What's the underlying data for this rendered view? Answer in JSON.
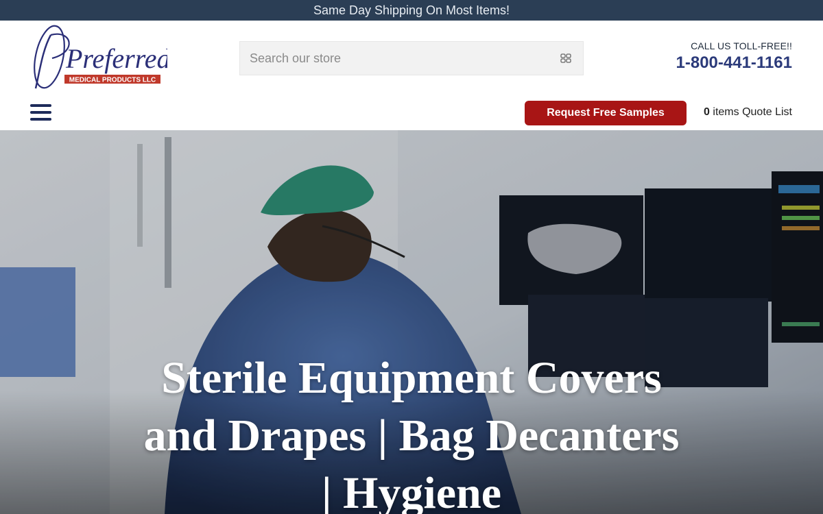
{
  "announcement": "Same Day Shipping On Most Items!",
  "logo": {
    "script_text": "Preferred",
    "banner_text": "MEDICAL PRODUCTS LLC"
  },
  "search": {
    "placeholder": "Search our store",
    "icon": "search-grid-icon"
  },
  "contact": {
    "label": "CALL US TOLL-FREE!!",
    "phone": "1-800-441-1161"
  },
  "nav": {
    "menu_icon": "hamburger-menu-icon",
    "samples_button": "Request Free Samples",
    "quote_count": "0",
    "quote_label": " items Quote List"
  },
  "hero": {
    "title": "Sterile Equipment Covers and Drapes | Bag Decanters | Hygiene"
  },
  "colors": {
    "announce_bg": "#2b3e55",
    "brand_navy": "#2b3a7a",
    "cta_red": "#a81515",
    "logo_red": "#c0392b"
  }
}
